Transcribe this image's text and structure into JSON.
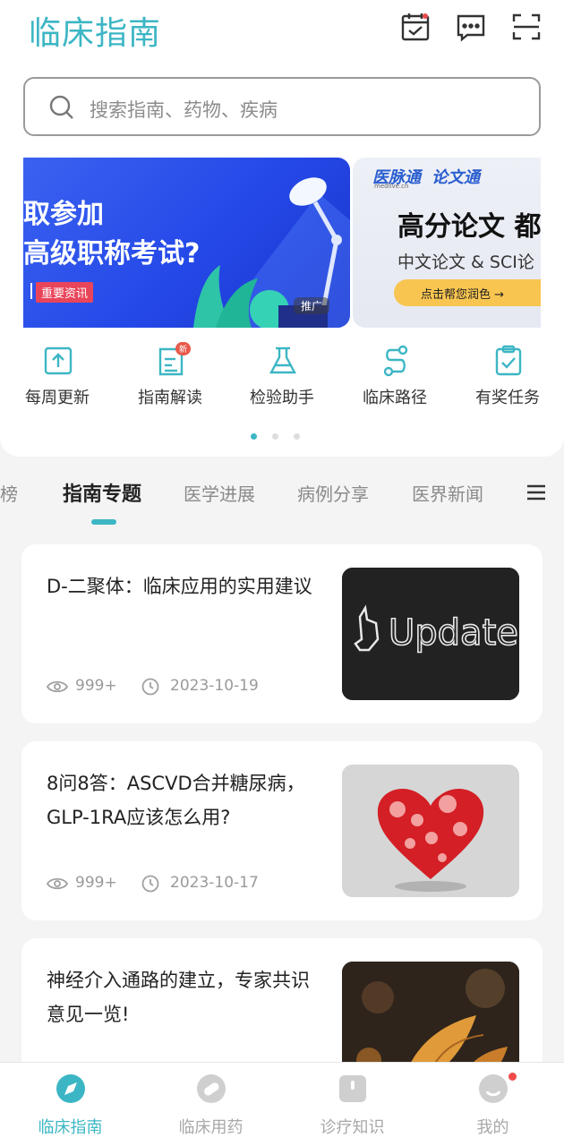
{
  "header": {
    "logo_text": "临床指南",
    "icons": [
      "calendar-check-icon",
      "message-dots-icon",
      "scan-icon"
    ]
  },
  "search": {
    "placeholder": "搜索指南、药物、疾病"
  },
  "banners": [
    {
      "line1": "取参加",
      "line2": "高级职称考试?",
      "tag": "重要资讯",
      "promo": "推广"
    },
    {
      "brand1": "医脉通",
      "brand2": "论文通",
      "brand_sub": "medlive.cn",
      "headline": "高分论文 都",
      "subline": "中文论文 & SCI论",
      "button": "点击帮您润色 →"
    }
  ],
  "quick_links": [
    {
      "label": "每周更新",
      "icon": "upload-icon"
    },
    {
      "label": "指南解读",
      "icon": "document-edit-icon",
      "badge": "新"
    },
    {
      "label": "检验助手",
      "icon": "flask-icon"
    },
    {
      "label": "临床路径",
      "icon": "route-icon"
    },
    {
      "label": "有奖任务",
      "icon": "clipboard-check-icon"
    }
  ],
  "pager": {
    "total": 3,
    "active": 0
  },
  "tabs": [
    {
      "label": "热榜"
    },
    {
      "label": "指南专题",
      "active": true
    },
    {
      "label": "医学进展"
    },
    {
      "label": "病例分享"
    },
    {
      "label": "医界新闻"
    }
  ],
  "articles": [
    {
      "title": "D-二聚体：临床应用的实用建议",
      "views": "999+",
      "date": "2023-10-19",
      "thumb_text": "Update"
    },
    {
      "title": "8问8答：ASCVD合并糖尿病，GLP-1RA应该怎么用?",
      "views": "999+",
      "date": "2023-10-17"
    },
    {
      "title": "神经介入通路的建立，专家共识意见一览!"
    }
  ],
  "bottom_nav": [
    {
      "label": "临床指南",
      "active": true
    },
    {
      "label": "临床用药"
    },
    {
      "label": "诊疗知识"
    },
    {
      "label": "我的",
      "dot": true
    }
  ],
  "colors": {
    "accent": "#3cb6c4",
    "badge_red": "#e8584a"
  }
}
